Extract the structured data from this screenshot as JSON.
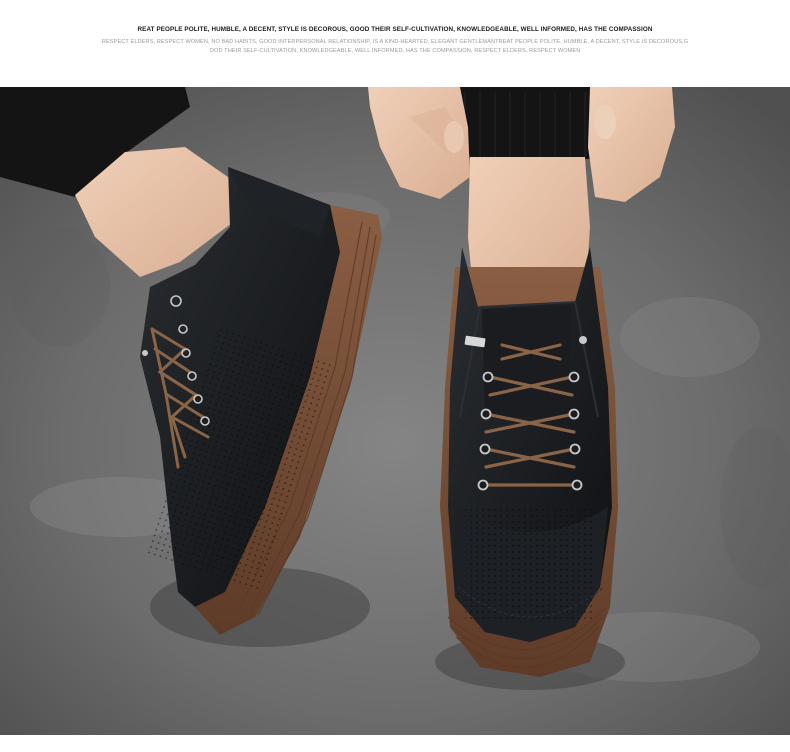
{
  "header": {
    "headline": "REAT PEOPLE POLITE, HUMBLE, A DECENT, STYLE IS DECOROUS, GOOD THEIR SELF-CULTIVATION, KNOWLEDGEABLE, WELL INFORMED, HAS THE COMPASSION",
    "subline_1": "RESPECT ELDERS, RESPECT WOMEN, NO BAD HABITS, GOOD INTERPERSONAL RELATIONSHIP, IS A KIND-HEARTED, ELEGANT GENTLEMANTREAT PEOPLE POLITE, HUMBLE, A DECENT, STYLE IS DECOROUS,G",
    "subline_2": "OOD THEIR SELF-CULTIVATION, KNOWLEDGEABLE, WELL INFORMED, HAS THE COMPASSION, RESPECT ELDERS, RESPECT WOMEN"
  },
  "colors": {
    "floor": "#6f6f6f",
    "leather": "#17191c",
    "sole": "#7a5038",
    "lace": "#8a6447",
    "skin": "#e8c4aa",
    "sleeve": "#141414"
  },
  "icons": {
    "shoe": "sneaker-icon",
    "hand": "hand-icon"
  }
}
